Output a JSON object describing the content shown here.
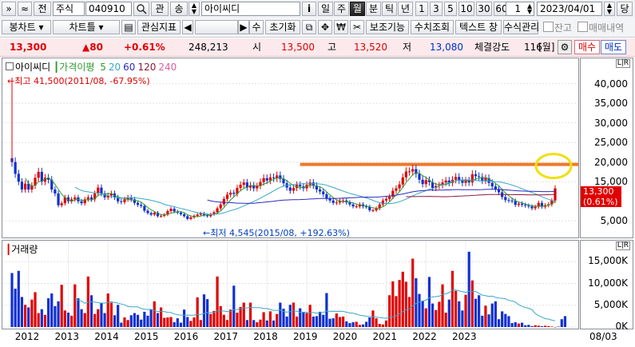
{
  "toolbar1": {
    "nav_prev": "»",
    "nav_up": "≈",
    "prev_label": "전",
    "market": "주식",
    "code": "040910",
    "search_icon": "magnifier-icon",
    "kwan": "관",
    "sang": "송",
    "stock_name": "아이씨디",
    "info": "i",
    "periods": [
      "일",
      "주",
      "월",
      "분",
      "틱",
      "년"
    ],
    "selected_period": "월",
    "minutes": [
      "1",
      "3",
      "5",
      "10",
      "30",
      "60"
    ],
    "count": "1",
    "date": "2023/04/01",
    "dang": "당"
  },
  "toolbar2": {
    "items": [
      "봉차트",
      "차트틀",
      "관심지표",
      "수",
      "초기화",
      "보조기능",
      "수치조회",
      "텍스트 창",
      "수식관리"
    ],
    "jango": "잔고",
    "trades": "매매내역"
  },
  "quote": {
    "price": "13,300",
    "change": "▲80",
    "pct": "+0.61%",
    "volume": "248,213",
    "open_label": "시",
    "open": "13,500",
    "high_label": "고",
    "high": "13,520",
    "low_label": "저",
    "low": "13,080",
    "strength_label": "체결강도",
    "strength": "116",
    "period_tag": "월",
    "buy": "매수",
    "sell": "매도"
  },
  "price_panel": {
    "name": "아이씨디",
    "ma_label": "가격이평",
    "ma": [
      {
        "n": "5",
        "color": "#2f9a2f"
      },
      {
        "n": "20",
        "color": "#3aa7c8"
      },
      {
        "n": "60",
        "color": "#2a2ac0"
      },
      {
        "n": "120",
        "color": "#8b1a3a"
      },
      {
        "n": "240",
        "color": "#e060a0"
      }
    ],
    "high_note": "←최고 41,500(2011/08, -67.95%)",
    "low_note": "←최저 4,545(2015/08, +192.63%)",
    "last_price": "13,300",
    "last_pct": "(0.61%)",
    "yticks": [
      {
        "label": "40,000",
        "value": 40000
      },
      {
        "label": "35,000",
        "value": 35000
      },
      {
        "label": "30,000",
        "value": 30000
      },
      {
        "label": "25,000",
        "value": 25000
      },
      {
        "label": "20,000",
        "value": 20000
      },
      {
        "label": "15,000",
        "value": 15000
      },
      {
        "label": "5,000",
        "value": 5000
      }
    ]
  },
  "volume_panel": {
    "name": "거래량",
    "yticks": [
      {
        "label": "15,000K",
        "value": 15000
      },
      {
        "label": "10,000K",
        "value": 10000
      },
      {
        "label": "5,000K",
        "value": 5000
      },
      {
        "label": "0K",
        "value": 0
      }
    ]
  },
  "xaxis": {
    "years": [
      "2012",
      "2013",
      "2014",
      "2015",
      "2016",
      "2017",
      "2018",
      "2019",
      "2020",
      "2021",
      "2022",
      "2023"
    ],
    "corner": "08/03"
  },
  "colors": {
    "up": "#e00000",
    "down": "#1030d0",
    "resistance": "#f07828",
    "highlight": "#f0e010"
  },
  "chart_data": {
    "type": "candlestick",
    "start": "2011/08",
    "interval": "monthly",
    "ylim": [
      2000,
      44000
    ],
    "close": [
      20000,
      17000,
      15000,
      13000,
      14500,
      13000,
      14000,
      16000,
      17500,
      15000,
      16000,
      15500,
      13000,
      12000,
      9000,
      9500,
      11000,
      10000,
      10500,
      11000,
      10000,
      9500,
      10500,
      11000,
      10500,
      12000,
      13500,
      12000,
      11000,
      11500,
      12000,
      11000,
      10000,
      9800,
      10500,
      11000,
      10500,
      9600,
      9100,
      8800,
      7600,
      7000,
      6600,
      7100,
      6200,
      6300,
      6600,
      7500,
      8100,
      7400,
      7100,
      6700,
      6200,
      5500,
      5900,
      6300,
      6600,
      6900,
      6500,
      6200,
      6700,
      7200,
      8200,
      9200,
      10600,
      11700,
      12200,
      11900,
      13400,
      14200,
      14800,
      13500,
      14100,
      13300,
      13900,
      14900,
      15900,
      15300,
      16100,
      15900,
      16600,
      15700,
      14600,
      13500,
      12700,
      13400,
      14200,
      13800,
      13300,
      14200,
      14800,
      14000,
      13000,
      12500,
      11800,
      10700,
      10200,
      9600,
      9700,
      10100,
      10200,
      9700,
      9200,
      8700,
      8700,
      9200,
      8700,
      8600,
      7700,
      7700,
      8200,
      9200,
      10200,
      10600,
      11200,
      12700,
      13300,
      14300,
      16100,
      17600,
      17600,
      18200,
      17000,
      15500,
      14400,
      15400,
      14900,
      13400,
      13900,
      14100,
      14800,
      15300,
      14700,
      15500,
      16200,
      15300,
      14700,
      15300,
      14800,
      16900,
      16400,
      16200,
      15300,
      15900,
      14700,
      13800,
      13100,
      12300,
      11100,
      10300,
      10200,
      10100,
      9100,
      9400,
      9100,
      8900,
      8700,
      8200,
      8600,
      9600,
      8600,
      9000,
      9200,
      10200,
      13300
    ],
    "volume": [
      12400,
      8800,
      12900,
      6900,
      5100,
      4500,
      6300,
      8000,
      3200,
      4100,
      2800,
      6600,
      7700,
      4800,
      5900,
      9700,
      3800,
      3300,
      2600,
      9800,
      6600,
      4100,
      3200,
      11600,
      7300,
      3000,
      4100,
      5600,
      3200,
      7700,
      5600,
      2700,
      5100,
      1000,
      2200,
      1600,
      2700,
      3200,
      2800,
      1700,
      3500,
      2600,
      4000,
      5900,
      3200,
      4500,
      2100,
      2200,
      2300,
      1100,
      2000,
      1000,
      4000,
      2300,
      1400,
      2200,
      6800,
      1600,
      7500,
      6400,
      3000,
      3700,
      11600,
      4800,
      2800,
      1600,
      4000,
      9500,
      3300,
      4600,
      5600,
      1600,
      5600,
      1600,
      1100,
      1700,
      3400,
      1500,
      3600,
      1500,
      3000,
      5600,
      4200,
      2400,
      5100,
      5600,
      2400,
      4300,
      3500,
      3200,
      5100,
      2400,
      2500,
      3500,
      2800,
      7800,
      1900,
      2000,
      3100,
      2300,
      2400,
      1300,
      900,
      1100,
      1200,
      500,
      600,
      1200,
      2200,
      3800,
      2000,
      700,
      600,
      1500,
      7300,
      10500,
      7100,
      10800,
      12700,
      10400,
      6900,
      15700,
      11200,
      7600,
      6000,
      4300,
      11500,
      5400,
      3900,
      5800,
      9800,
      3300,
      6300,
      12900,
      8300,
      5900,
      3800,
      7400,
      17300,
      10700,
      6500,
      7300,
      2600,
      4900,
      2900,
      5400,
      5900,
      1800,
      3600,
      3000,
      2500,
      900,
      1100,
      800,
      1000,
      400,
      500,
      200,
      400,
      300,
      200,
      300,
      200,
      100,
      0,
      100,
      1800,
      2500
    ]
  }
}
